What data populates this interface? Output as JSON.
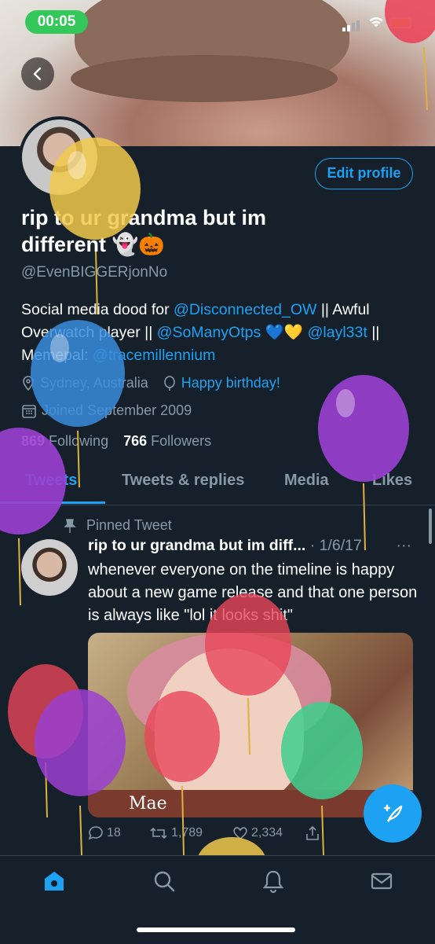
{
  "status_bar": {
    "time": "00:05"
  },
  "profile": {
    "name": "rip to ur grandma but im different 👻🎃",
    "handle": "@EvenBIGGERjonNo",
    "edit_button": "Edit profile",
    "bio": {
      "t1": "Social media dood for ",
      "link1": "@Disconnected_OW",
      "t2": " || Awful Overwatch player || ",
      "link2": "@SoManyOtps",
      "t3": " 💙💛 ",
      "link3": "@layl33t",
      "t4": " || Memepal: ",
      "link4": "@tracemillennium"
    },
    "location": "Sydney, Australia",
    "birthday": "Happy birthday!",
    "joined": "Joined September 2009",
    "following_count": "869",
    "following_label": " Following",
    "followers_count": "766",
    "followers_label": " Followers"
  },
  "tabs": [
    "Tweets",
    "Tweets & replies",
    "Media",
    "Likes"
  ],
  "pinned_tweet": {
    "pinned_label": "Pinned Tweet",
    "author": "rip to ur grandma but im diff...",
    "date": " · 1/6/17",
    "more": "···",
    "text": "whenever everyone on the timeline is happy about a new game release and that one person is always like \"lol it looks shit\"",
    "media_caption": "Mae",
    "replies": "18",
    "retweets": "1,789",
    "likes": "2,334"
  },
  "colors": {
    "background": "#15202b",
    "accent": "#1da1f2",
    "muted": "#8899a6",
    "divider": "#38444d"
  },
  "icons": [
    "back-arrow-icon",
    "location-icon",
    "balloon-birthday-icon",
    "calendar-icon",
    "pin-icon",
    "reply-icon",
    "retweet-icon",
    "like-icon",
    "share-icon",
    "compose-icon",
    "home-icon",
    "search-icon",
    "notifications-icon",
    "messages-icon"
  ]
}
